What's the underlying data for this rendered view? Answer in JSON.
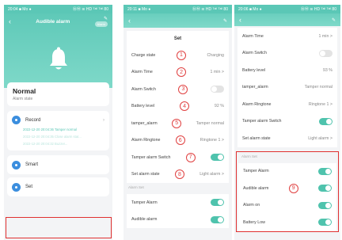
{
  "phone1": {
    "status": {
      "time": "20:04 ■ Mo ●",
      "signal": "ⓃⓂ ≋ HD ᵀᵃˡˡ ᵀᵃˡˡ 80"
    },
    "title": "Audible alarm",
    "pill": "Alarm",
    "state_value": "Normal",
    "state_label": "Alarm state",
    "record_label": "Record",
    "records": [
      "2022-12-20 20:04:36 Tamper normal",
      "2022-12-20 20:04:35 Close alarm stat...",
      "2022-12-20 20:04:32 Buzzer..."
    ],
    "smart_label": "Smart",
    "set_label": "Set"
  },
  "phone2": {
    "status": {
      "time": "20:11 ■ Mo ●",
      "signal": "ⓃⓂ ≋ HD ᵀᵃˡˡ ᵀᵃˡˡ 80"
    },
    "title": "Set",
    "rows": [
      {
        "label": "Charge state",
        "num": "1",
        "value": "Charging"
      },
      {
        "label": "Alarm Time",
        "num": "2",
        "value": "1 min >"
      },
      {
        "label": "Alarm Switch",
        "num": "3",
        "value": ""
      },
      {
        "label": "Battery level",
        "num": "4",
        "value": "92 %"
      },
      {
        "label": "tamper_alarm",
        "num": "5",
        "value": "Tamper normal"
      },
      {
        "label": "Alarm Ringtone",
        "num": "6",
        "value": "Ringtone 1 >"
      },
      {
        "label": "Tamper alarm Switch",
        "num": "7",
        "value": ""
      },
      {
        "label": "Set alarm state",
        "num": "8",
        "value": "Light alarm >"
      }
    ],
    "section": "Alarm Set",
    "bottom_rows": [
      "Tamper Alarm",
      "Audible alarm"
    ]
  },
  "phone3": {
    "status": {
      "time": "20:06 ■ Mo ●",
      "signal": "ⓃⓂ ≋ HD ᵀᵃˡˡ ᵀᵃˡˡ 80"
    },
    "rows": [
      {
        "label": "Alarm Time",
        "value": "1 min >"
      },
      {
        "label": "Alarm Switch",
        "value": ""
      },
      {
        "label": "Battery level",
        "value": "93 %"
      },
      {
        "label": "tamper_alarm",
        "value": "Tamper normal"
      },
      {
        "label": "Alarm Ringtone",
        "value": "Ringtone 1 >"
      },
      {
        "label": "Tamper alarm Switch",
        "value": ""
      },
      {
        "label": "Set alarm state",
        "value": "Light alarm >"
      }
    ],
    "section": "Alarm Set",
    "alarm_rows": [
      "Tamper Alarm",
      "Audible alarm",
      "Alarm on",
      "Battery Low"
    ],
    "group_num": "9"
  },
  "colors": {
    "accent": "#5bc7b6",
    "toggle_on": "#4fc3ad",
    "marker": "#e04040",
    "record_dot": "#3b8ede"
  },
  "icons": [
    "back-arrow-icon",
    "edit-pen-icon",
    "bell-icon",
    "chevron-right-icon"
  ]
}
